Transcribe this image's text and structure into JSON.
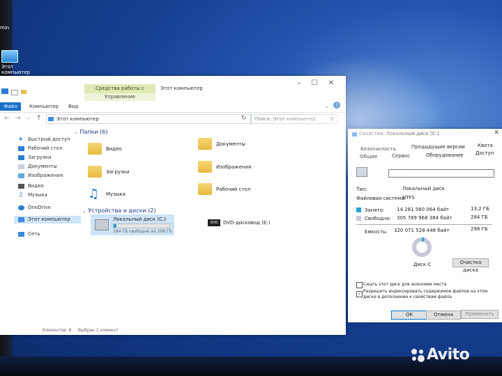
{
  "desktop": {
    "icon_top_label": "min",
    "icon_this_pc_lines": [
      "Этот",
      "компьютер"
    ]
  },
  "explorer": {
    "context_tab_title": "Средства работы с дисками",
    "context_tab_sub": "Управление",
    "window_title": "Этот компьютер",
    "ribbon_tabs": [
      "Файл",
      "Компьютер",
      "Вид"
    ],
    "address_path": "Этот компьютер",
    "search_placeholder": "Поиск: Этот компьютер",
    "nav": {
      "quick_access": "Быстрый доступ",
      "items": [
        "Рабочий стол",
        "Загрузки",
        "Документы",
        "Изображения",
        "Видео",
        "Музыка"
      ],
      "onedrive": "OneDrive",
      "this_pc": "Этот компьютер",
      "network": "Сеть"
    },
    "folders_header": "Папки (6)",
    "folders": [
      "Видео",
      "Документы",
      "Загрузки",
      "Изображения",
      "Музыка",
      "Рабочий стол"
    ],
    "devices_header": "Устройства и диски (2)",
    "drive_c": {
      "name": "Локальный диск (C:)",
      "free_text": "284 ГБ свободно из 298 ГБ",
      "used_fraction": 0.05
    },
    "dvd": {
      "badge": "DVD",
      "name": "DVD-дисковод (E:)"
    },
    "status": {
      "items": "Элементов: 8",
      "selected": "Выбран 1 элемент"
    }
  },
  "properties": {
    "title": "Свойства: Локальный диск (C:)",
    "tabs_row1": [
      "Безопасность",
      "Предыдущие версии",
      "Квота"
    ],
    "tabs_row2": [
      "Общие",
      "Сервис",
      "Оборудование",
      "Доступ"
    ],
    "type_label": "Тип:",
    "type_value": "Локальный диск",
    "fs_label": "Файловая система:",
    "fs_value": "NTFS",
    "used_label": "Занято:",
    "used_bytes": "14 281 560 064 байт",
    "used_gb": "13,2 ГБ",
    "free_label": "Свободно:",
    "free_bytes": "305 789 968 384 байт",
    "free_gb": "284 ГБ",
    "capacity_label": "Емкость:",
    "capacity_bytes": "320 071 528 448 байт",
    "capacity_gb": "298 ГБ",
    "disk_label": "Диск C",
    "cleanup_button": "Очистка диска",
    "compress_label": "Сжать этот диск для экономии места",
    "index_label_1": "Разрешить индексировать содержимое файлов на этом",
    "index_label_2": "диске в дополнение к свойствам файла",
    "ok_button": "OK",
    "cancel_button": "Отмена",
    "apply_button": "Применить",
    "used_fraction": 0.045,
    "colors": {
      "used": "#26a0da",
      "free": "#c8c8d8"
    }
  },
  "watermark": "Avito"
}
